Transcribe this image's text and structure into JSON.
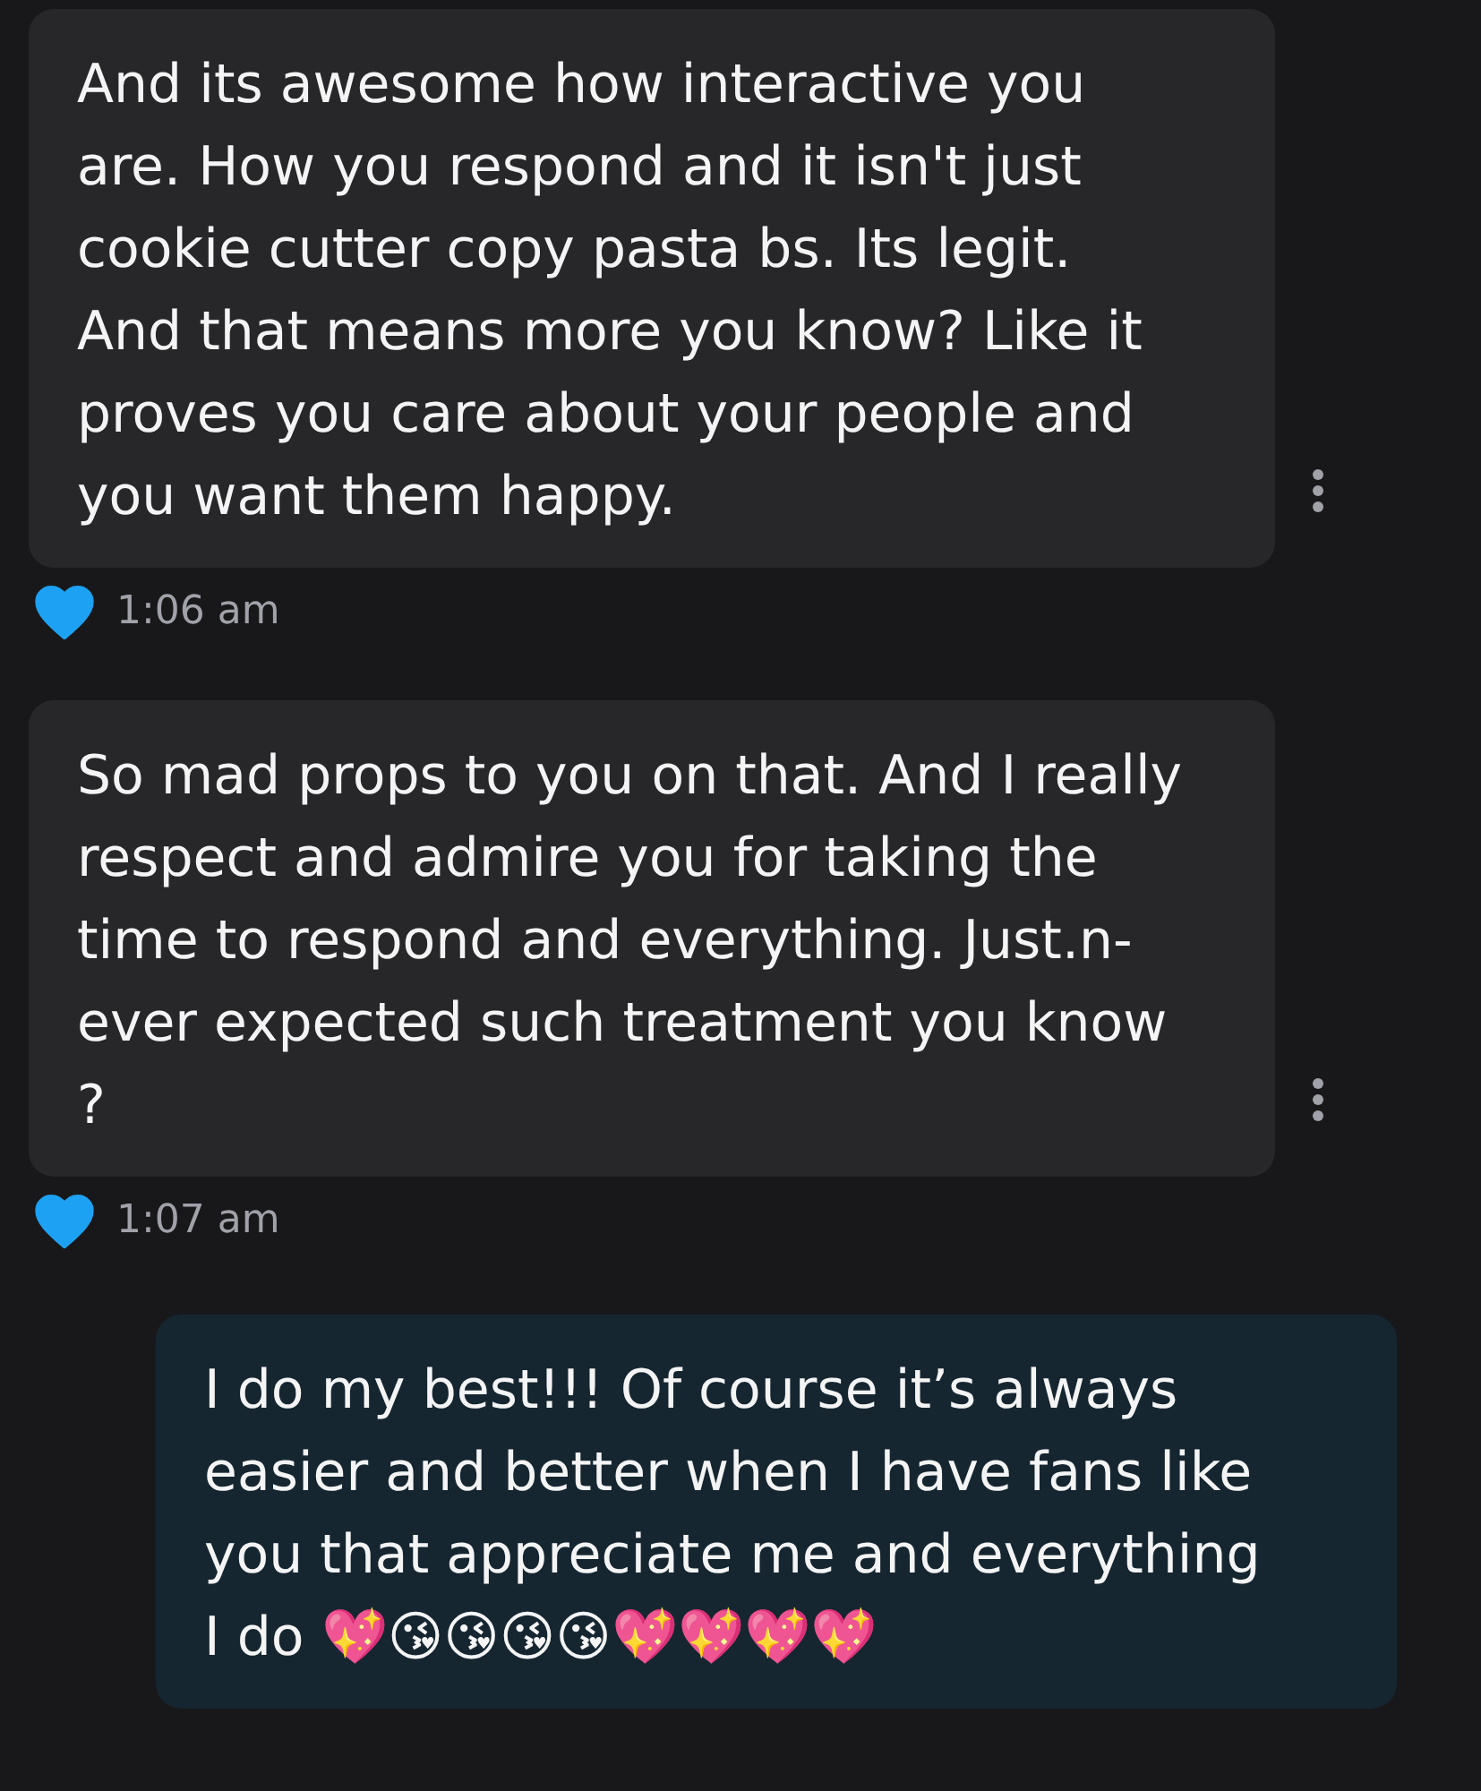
{
  "messages": [
    {
      "kind": "received",
      "lines": [
        "And its awesome how interactive you",
        "are. How you respond and it isn't just",
        "cookie cutter copy pasta bs. Its legit.",
        "And that means more you know? Like it",
        "proves you care about your people and",
        "you want them happy."
      ],
      "liked": true,
      "time": "1:06 am"
    },
    {
      "kind": "received",
      "lines": [
        "So mad props to you on that. And I really",
        "respect and admire you for taking the",
        "time to respond and everything. Just.n-",
        "ever expected such treatment you know",
        "?"
      ],
      "liked": true,
      "time": "1:07 am"
    },
    {
      "kind": "sent",
      "lines": [
        "I do my best!!! Of course it’s always",
        "easier and better when I have fans like",
        "you that appreciate me and everything",
        "I do 💖😘😘😘😘💖💖💖💖"
      ]
    }
  ]
}
